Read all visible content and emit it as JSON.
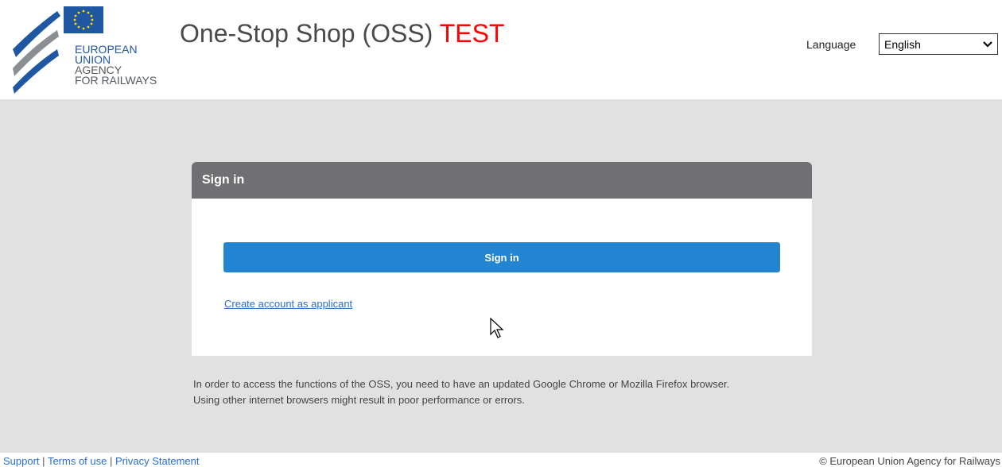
{
  "header": {
    "logo": {
      "line1": "EUROPEAN",
      "line2": "UNION",
      "line3": "AGENCY",
      "line4": "FOR RAILWAYS",
      "flag_color": "#1f57a3",
      "stripe_color": "#1f57a3"
    },
    "title": "One-Stop Shop (OSS)",
    "title_suffix": "TEST",
    "language_label": "Language",
    "language_selected": "English"
  },
  "signin_panel": {
    "heading": "Sign in",
    "button_label": "Sign in",
    "create_account_link": "Create account as applicant"
  },
  "info": {
    "line1": "In order to access the functions of the OSS, you need to have an updated Google Chrome or Mozilla Firefox browser.",
    "line2": "Using other internet browsers might result in poor performance or errors."
  },
  "footer": {
    "links": [
      "Support",
      "Terms of use",
      "Privacy Statement"
    ],
    "separator": "|",
    "copyright": "© European Union Agency for Railways"
  },
  "colors": {
    "accent": "#2384d1",
    "panel_header": "#707072",
    "background": "#e1e1e1",
    "test_red": "#ff0000"
  }
}
